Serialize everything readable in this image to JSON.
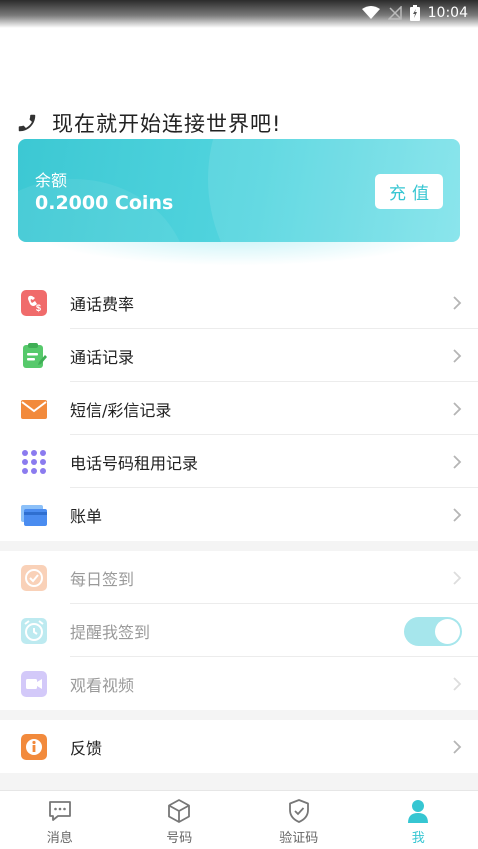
{
  "status_bar": {
    "time": "10:04"
  },
  "greeting": {
    "text": "现在就开始连接世界吧!"
  },
  "balance_card": {
    "label": "余额",
    "value": "0.2000 Coins",
    "recharge_label": "充值"
  },
  "menu_main": [
    {
      "label": "通话费率",
      "icon": "call-rate-icon",
      "color": "#f06b6b"
    },
    {
      "label": "通话记录",
      "icon": "clipboard-icon",
      "color": "#56c96b"
    },
    {
      "label": "短信/彩信记录",
      "icon": "envelope-icon",
      "color": "#f28a3c"
    },
    {
      "label": "电话号码租用记录",
      "icon": "dialpad-icon",
      "color": "#8b7bef"
    },
    {
      "label": "账单",
      "icon": "bill-icon",
      "color": "#4a8cf0"
    }
  ],
  "menu_tasks": [
    {
      "label": "每日签到",
      "icon": "checkin-icon",
      "color": "#f39a63"
    },
    {
      "label": "提醒我签到",
      "icon": "alarm-icon",
      "color": "#6fd2e0",
      "toggle_on": true
    },
    {
      "label": "观看视频",
      "icon": "video-icon",
      "color": "#a08af2"
    }
  ],
  "menu_feedback": [
    {
      "label": "反馈",
      "icon": "info-icon",
      "color": "#f28a3c"
    }
  ],
  "bottom_nav": [
    {
      "label": "消息",
      "icon": "message-icon"
    },
    {
      "label": "号码",
      "icon": "cube-icon"
    },
    {
      "label": "验证码",
      "icon": "shield-check-icon"
    },
    {
      "label": "我",
      "icon": "person-icon",
      "active": true
    }
  ],
  "colors": {
    "accent": "#36c6d2",
    "accent_light": "#a6e6ec"
  }
}
